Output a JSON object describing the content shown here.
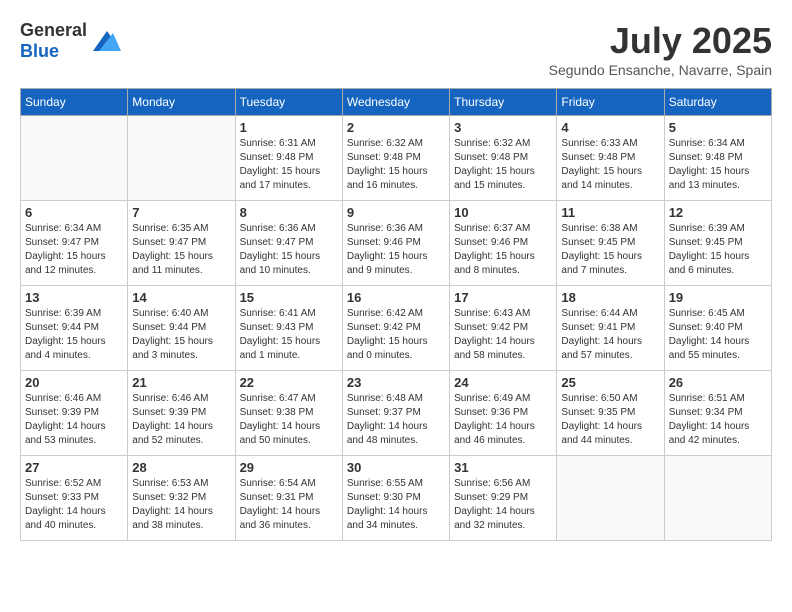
{
  "header": {
    "logo_general": "General",
    "logo_blue": "Blue",
    "month_title": "July 2025",
    "subtitle": "Segundo Ensanche, Navarre, Spain"
  },
  "weekdays": [
    "Sunday",
    "Monday",
    "Tuesday",
    "Wednesday",
    "Thursday",
    "Friday",
    "Saturday"
  ],
  "weeks": [
    [
      {
        "day": "",
        "sunrise": "",
        "sunset": "",
        "daylight": ""
      },
      {
        "day": "",
        "sunrise": "",
        "sunset": "",
        "daylight": ""
      },
      {
        "day": "1",
        "sunrise": "Sunrise: 6:31 AM",
        "sunset": "Sunset: 9:48 PM",
        "daylight": "Daylight: 15 hours and 17 minutes."
      },
      {
        "day": "2",
        "sunrise": "Sunrise: 6:32 AM",
        "sunset": "Sunset: 9:48 PM",
        "daylight": "Daylight: 15 hours and 16 minutes."
      },
      {
        "day": "3",
        "sunrise": "Sunrise: 6:32 AM",
        "sunset": "Sunset: 9:48 PM",
        "daylight": "Daylight: 15 hours and 15 minutes."
      },
      {
        "day": "4",
        "sunrise": "Sunrise: 6:33 AM",
        "sunset": "Sunset: 9:48 PM",
        "daylight": "Daylight: 15 hours and 14 minutes."
      },
      {
        "day": "5",
        "sunrise": "Sunrise: 6:34 AM",
        "sunset": "Sunset: 9:48 PM",
        "daylight": "Daylight: 15 hours and 13 minutes."
      }
    ],
    [
      {
        "day": "6",
        "sunrise": "Sunrise: 6:34 AM",
        "sunset": "Sunset: 9:47 PM",
        "daylight": "Daylight: 15 hours and 12 minutes."
      },
      {
        "day": "7",
        "sunrise": "Sunrise: 6:35 AM",
        "sunset": "Sunset: 9:47 PM",
        "daylight": "Daylight: 15 hours and 11 minutes."
      },
      {
        "day": "8",
        "sunrise": "Sunrise: 6:36 AM",
        "sunset": "Sunset: 9:47 PM",
        "daylight": "Daylight: 15 hours and 10 minutes."
      },
      {
        "day": "9",
        "sunrise": "Sunrise: 6:36 AM",
        "sunset": "Sunset: 9:46 PM",
        "daylight": "Daylight: 15 hours and 9 minutes."
      },
      {
        "day": "10",
        "sunrise": "Sunrise: 6:37 AM",
        "sunset": "Sunset: 9:46 PM",
        "daylight": "Daylight: 15 hours and 8 minutes."
      },
      {
        "day": "11",
        "sunrise": "Sunrise: 6:38 AM",
        "sunset": "Sunset: 9:45 PM",
        "daylight": "Daylight: 15 hours and 7 minutes."
      },
      {
        "day": "12",
        "sunrise": "Sunrise: 6:39 AM",
        "sunset": "Sunset: 9:45 PM",
        "daylight": "Daylight: 15 hours and 6 minutes."
      }
    ],
    [
      {
        "day": "13",
        "sunrise": "Sunrise: 6:39 AM",
        "sunset": "Sunset: 9:44 PM",
        "daylight": "Daylight: 15 hours and 4 minutes."
      },
      {
        "day": "14",
        "sunrise": "Sunrise: 6:40 AM",
        "sunset": "Sunset: 9:44 PM",
        "daylight": "Daylight: 15 hours and 3 minutes."
      },
      {
        "day": "15",
        "sunrise": "Sunrise: 6:41 AM",
        "sunset": "Sunset: 9:43 PM",
        "daylight": "Daylight: 15 hours and 1 minute."
      },
      {
        "day": "16",
        "sunrise": "Sunrise: 6:42 AM",
        "sunset": "Sunset: 9:42 PM",
        "daylight": "Daylight: 15 hours and 0 minutes."
      },
      {
        "day": "17",
        "sunrise": "Sunrise: 6:43 AM",
        "sunset": "Sunset: 9:42 PM",
        "daylight": "Daylight: 14 hours and 58 minutes."
      },
      {
        "day": "18",
        "sunrise": "Sunrise: 6:44 AM",
        "sunset": "Sunset: 9:41 PM",
        "daylight": "Daylight: 14 hours and 57 minutes."
      },
      {
        "day": "19",
        "sunrise": "Sunrise: 6:45 AM",
        "sunset": "Sunset: 9:40 PM",
        "daylight": "Daylight: 14 hours and 55 minutes."
      }
    ],
    [
      {
        "day": "20",
        "sunrise": "Sunrise: 6:46 AM",
        "sunset": "Sunset: 9:39 PM",
        "daylight": "Daylight: 14 hours and 53 minutes."
      },
      {
        "day": "21",
        "sunrise": "Sunrise: 6:46 AM",
        "sunset": "Sunset: 9:39 PM",
        "daylight": "Daylight: 14 hours and 52 minutes."
      },
      {
        "day": "22",
        "sunrise": "Sunrise: 6:47 AM",
        "sunset": "Sunset: 9:38 PM",
        "daylight": "Daylight: 14 hours and 50 minutes."
      },
      {
        "day": "23",
        "sunrise": "Sunrise: 6:48 AM",
        "sunset": "Sunset: 9:37 PM",
        "daylight": "Daylight: 14 hours and 48 minutes."
      },
      {
        "day": "24",
        "sunrise": "Sunrise: 6:49 AM",
        "sunset": "Sunset: 9:36 PM",
        "daylight": "Daylight: 14 hours and 46 minutes."
      },
      {
        "day": "25",
        "sunrise": "Sunrise: 6:50 AM",
        "sunset": "Sunset: 9:35 PM",
        "daylight": "Daylight: 14 hours and 44 minutes."
      },
      {
        "day": "26",
        "sunrise": "Sunrise: 6:51 AM",
        "sunset": "Sunset: 9:34 PM",
        "daylight": "Daylight: 14 hours and 42 minutes."
      }
    ],
    [
      {
        "day": "27",
        "sunrise": "Sunrise: 6:52 AM",
        "sunset": "Sunset: 9:33 PM",
        "daylight": "Daylight: 14 hours and 40 minutes."
      },
      {
        "day": "28",
        "sunrise": "Sunrise: 6:53 AM",
        "sunset": "Sunset: 9:32 PM",
        "daylight": "Daylight: 14 hours and 38 minutes."
      },
      {
        "day": "29",
        "sunrise": "Sunrise: 6:54 AM",
        "sunset": "Sunset: 9:31 PM",
        "daylight": "Daylight: 14 hours and 36 minutes."
      },
      {
        "day": "30",
        "sunrise": "Sunrise: 6:55 AM",
        "sunset": "Sunset: 9:30 PM",
        "daylight": "Daylight: 14 hours and 34 minutes."
      },
      {
        "day": "31",
        "sunrise": "Sunrise: 6:56 AM",
        "sunset": "Sunset: 9:29 PM",
        "daylight": "Daylight: 14 hours and 32 minutes."
      },
      {
        "day": "",
        "sunrise": "",
        "sunset": "",
        "daylight": ""
      },
      {
        "day": "",
        "sunrise": "",
        "sunset": "",
        "daylight": ""
      }
    ]
  ]
}
